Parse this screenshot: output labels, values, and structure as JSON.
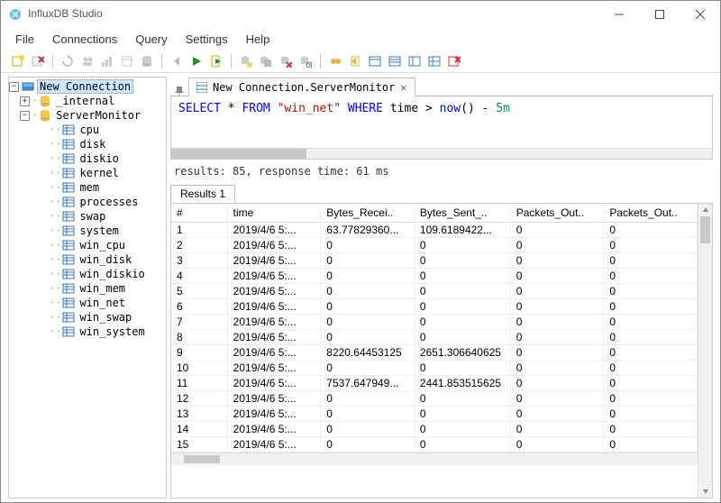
{
  "window": {
    "title": "InfluxDB Studio"
  },
  "menubar": [
    "File",
    "Connections",
    "Query",
    "Settings",
    "Help"
  ],
  "tree": {
    "root": "New Connection",
    "db1": "_internal",
    "db2": "ServerMonitor",
    "measurements": [
      "cpu",
      "disk",
      "diskio",
      "kernel",
      "mem",
      "processes",
      "swap",
      "system",
      "win_cpu",
      "win_disk",
      "win_diskio",
      "win_mem",
      "win_net",
      "win_swap",
      "win_system"
    ]
  },
  "tab": {
    "label": "New Connection.ServerMonitor"
  },
  "query_tokens": {
    "t1": "SELECT",
    "t2": " * ",
    "t3": "FROM",
    "t4": " ",
    "t5": "\"win_net\"",
    "t6": " ",
    "t7": "WHERE",
    "t8": " time > ",
    "t9": "now",
    "t10": "() - ",
    "t11": "5m"
  },
  "status": "results: 85, response time: 61 ms",
  "results_tab": "Results 1",
  "columns": [
    "#",
    "time",
    "Bytes_Recei..",
    "Bytes_Sent_..",
    "Packets_Out..",
    "Packets_Out.."
  ],
  "rows": [
    {
      "n": "1",
      "time": "2019/4/6 5:...",
      "c1": "63.77829360...",
      "c2": "109.6189422...",
      "c3": "0",
      "c4": "0"
    },
    {
      "n": "2",
      "time": "2019/4/6 5:...",
      "c1": "0",
      "c2": "0",
      "c3": "0",
      "c4": "0"
    },
    {
      "n": "3",
      "time": "2019/4/6 5:...",
      "c1": "0",
      "c2": "0",
      "c3": "0",
      "c4": "0"
    },
    {
      "n": "4",
      "time": "2019/4/6 5:...",
      "c1": "0",
      "c2": "0",
      "c3": "0",
      "c4": "0"
    },
    {
      "n": "5",
      "time": "2019/4/6 5:...",
      "c1": "0",
      "c2": "0",
      "c3": "0",
      "c4": "0"
    },
    {
      "n": "6",
      "time": "2019/4/6 5:...",
      "c1": "0",
      "c2": "0",
      "c3": "0",
      "c4": "0"
    },
    {
      "n": "7",
      "time": "2019/4/6 5:...",
      "c1": "0",
      "c2": "0",
      "c3": "0",
      "c4": "0"
    },
    {
      "n": "8",
      "time": "2019/4/6 5:...",
      "c1": "0",
      "c2": "0",
      "c3": "0",
      "c4": "0"
    },
    {
      "n": "9",
      "time": "2019/4/6 5:...",
      "c1": "8220.64453125",
      "c2": "2651.306640625",
      "c3": "0",
      "c4": "0"
    },
    {
      "n": "10",
      "time": "2019/4/6 5:...",
      "c1": "0",
      "c2": "0",
      "c3": "0",
      "c4": "0"
    },
    {
      "n": "11",
      "time": "2019/4/6 5:...",
      "c1": "7537.647949...",
      "c2": "2441.853515625",
      "c3": "0",
      "c4": "0"
    },
    {
      "n": "12",
      "time": "2019/4/6 5:...",
      "c1": "0",
      "c2": "0",
      "c3": "0",
      "c4": "0"
    },
    {
      "n": "13",
      "time": "2019/4/6 5:...",
      "c1": "0",
      "c2": "0",
      "c3": "0",
      "c4": "0"
    },
    {
      "n": "14",
      "time": "2019/4/6 5:...",
      "c1": "0",
      "c2": "0",
      "c3": "0",
      "c4": "0"
    },
    {
      "n": "15",
      "time": "2019/4/6 5:...",
      "c1": "0",
      "c2": "0",
      "c3": "0",
      "c4": "0"
    }
  ]
}
